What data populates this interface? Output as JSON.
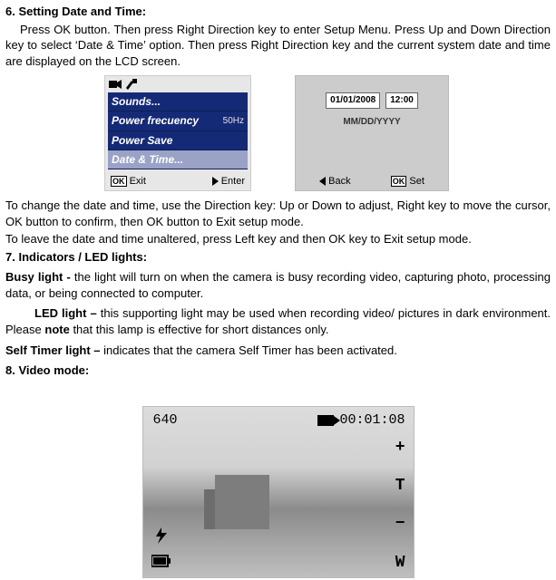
{
  "s6": {
    "title": "6. Setting Date and Time:",
    "body": "Press OK button. Then press Right Direction key to enter Setup Menu. Press Up and Down Direction key to select ‘Date & Time’ option. Then press Right Direction key and the current system date and time are displayed on the LCD screen."
  },
  "lcd1": {
    "menu": [
      "Sounds...",
      "Power frecuency",
      "Power Save",
      "Date & Time..."
    ],
    "freq_suffix": "50Hz",
    "exit_label": "Exit",
    "enter_label": "Enter",
    "ok": "OK"
  },
  "lcd2": {
    "date": "01/01/2008",
    "time": "12:00",
    "format": "MM/DD/YYYY",
    "back": "Back",
    "set": "Set",
    "ok": "OK"
  },
  "s6b": {
    "p1": "To change the date and time, use the Direction key: Up or Down to adjust, Right key to move the cursor, OK button to confirm, then OK button to Exit setup mode.",
    "p2": "To leave the date and time unaltered, press Left key and then OK key to Exit setup mode."
  },
  "s7": {
    "title": "7. Indicators / LED lights:",
    "busy_label": "Busy light - ",
    "busy_text": "the light will turn on when the camera is busy recording video, capturing photo, processing data, or being connected to computer.",
    "led_label": "LED light – ",
    "led_text_a": "this supporting light may be used when recording video/ pictures in dark environment.    Please ",
    "note": "note",
    "led_text_b": " that this lamp is effective for short distances only.",
    "self_label": "Self Timer light – ",
    "self_text": "indicates that the camera Self Timer has been activated."
  },
  "s8": {
    "title": "8. Video mode:"
  },
  "vid": {
    "res": "640",
    "time": "00:01:08",
    "plus": "+",
    "t": "T",
    "minus": "−",
    "w": "W"
  }
}
